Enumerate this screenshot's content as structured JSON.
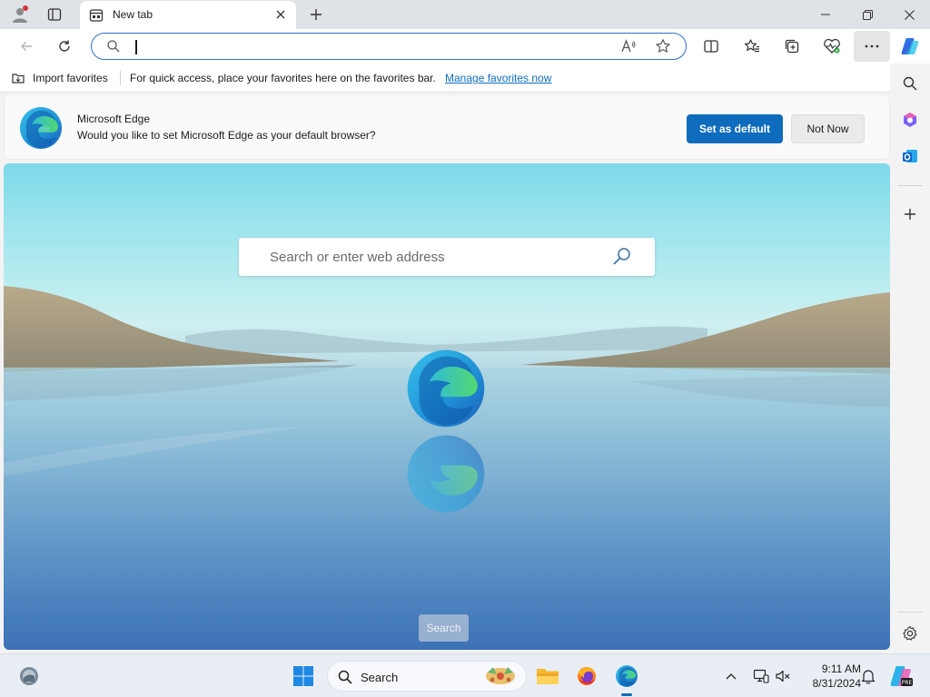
{
  "window": {
    "tab_title": "New tab",
    "minimize_glyph": "—",
    "maximize_glyph": "❐",
    "close_glyph": "✕"
  },
  "toolbar": {
    "address_value": "",
    "icons": [
      "back-icon",
      "refresh-icon",
      "search-icon",
      "read-aloud-icon",
      "favorite-star-icon",
      "split-screen-icon",
      "favorites-icon",
      "collections-icon",
      "browser-essentials-icon",
      "more-icon",
      "copilot-icon"
    ]
  },
  "favorites_bar": {
    "import_label": "Import favorites",
    "message": "For quick access, place your favorites here on the favorites bar.",
    "manage_link": "Manage favorites now"
  },
  "banner": {
    "title": "Microsoft Edge",
    "subtitle": "Would you like to set Microsoft Edge as your default browser?",
    "primary_button": "Set as default",
    "secondary_button": "Not Now"
  },
  "ntp": {
    "search_placeholder": "Search or enter web address",
    "search_button": "Search"
  },
  "sidebar": {
    "icons": [
      "search-icon",
      "copilot-m365-icon",
      "outlook-icon",
      "add-icon",
      "settings-icon"
    ]
  },
  "taskbar": {
    "search_label": "Search",
    "time": "9:11 AM",
    "date": "8/31/2024",
    "apps": [
      "widgets-icon",
      "start-icon",
      "file-explorer-icon",
      "firefox-icon",
      "edge-icon"
    ]
  },
  "colors": {
    "accent": "#0f6cbd",
    "omnibox_border": "#2f6fca",
    "tab_bar": "#dfe2e7"
  }
}
